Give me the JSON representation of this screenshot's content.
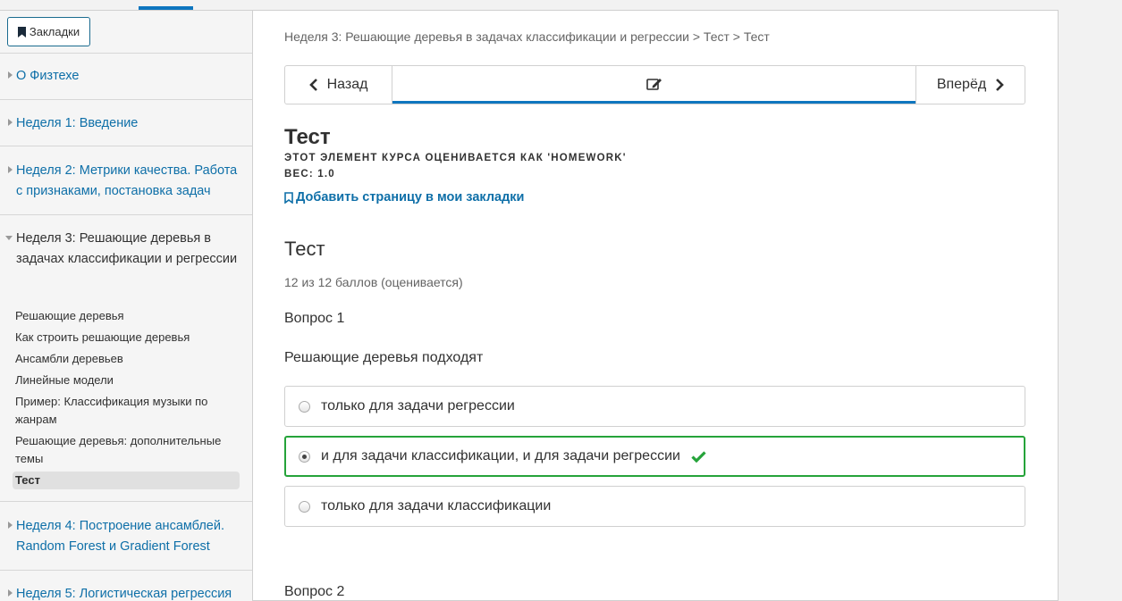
{
  "sidebar": {
    "bookmarks_label": "Закладки",
    "chapters_before": [
      {
        "label": "О Физтехе"
      },
      {
        "label": "Неделя 1: Введение"
      },
      {
        "label": "Неделя 2: Метрики качества. Работа с признаками, постановка задач"
      }
    ],
    "active_chapter": {
      "label": "Неделя 3: Решающие деревья в задачах классификации и регрессии",
      "sequences": [
        "Решающие деревья",
        "Как строить решающие деревья",
        "Ансамбли деревьев",
        "Линейные модели",
        "Пример: Классификация музыки по жанрам",
        "Решающие деревья: дополнительные темы",
        "Тест"
      ]
    },
    "chapters_after": [
      {
        "label": "Неделя 4: Построение ансамблей. Random Forest и Gradient Forest"
      },
      {
        "label": "Неделя 5: Логистическая регрессия"
      }
    ]
  },
  "main": {
    "breadcrumb": "Неделя 3: Решающие деревья в задачах классификации и регрессии > Тест > Тест",
    "nav": {
      "prev_label": "Назад",
      "next_label": "Вперёд"
    },
    "unit_title": "Тест",
    "graded_note": "ЭТОТ ЭЛЕМЕНТ КУРСА ОЦЕНИВАЕТСЯ КАК 'HOMEWORK'",
    "weight": "ВЕС: 1.0",
    "add_bookmark": "Добавить страницу в мои закладки",
    "problem_title": "Тест",
    "score": "12 из 12 баллов (оценивается)",
    "question1": {
      "number": "Вопрос 1",
      "text": "Решающие деревья подходят",
      "choices": [
        {
          "label": "только для задачи регрессии",
          "selected": false,
          "correct": false
        },
        {
          "label": "и для задачи классификации, и для задачи регрессии",
          "selected": true,
          "correct": true
        },
        {
          "label": "только для задачи классификации",
          "selected": false,
          "correct": false
        }
      ]
    },
    "question2": {
      "number": "Вопрос 2"
    }
  },
  "colors": {
    "accent": "#0e76bf",
    "link": "#0e6fa8",
    "correct": "#25a33a"
  }
}
